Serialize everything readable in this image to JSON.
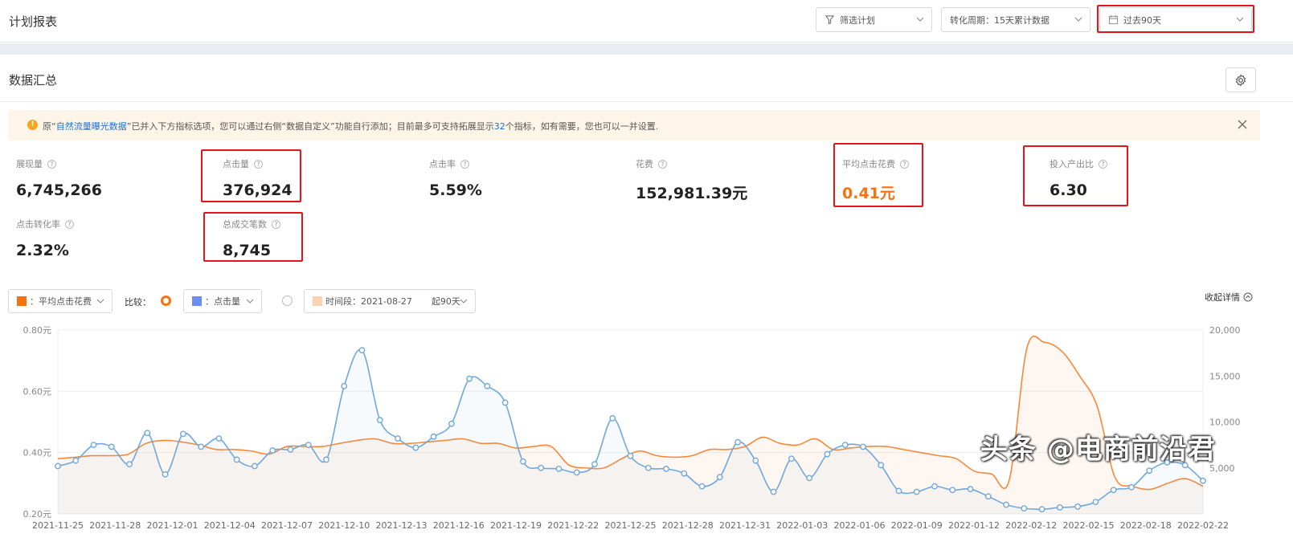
{
  "header": {
    "title": "计划报表",
    "filter_label": "筛选计划",
    "period_label": "转化周期：15天累计数据",
    "range_label": "过去90天"
  },
  "summary": {
    "title": "数据汇总",
    "notice_pre": "原“",
    "notice_link": "自然流量曝光数据",
    "notice_mid": "”已并入下方指标选项，您可以通过右侧“数据自定义”功能自行添加；目前最多可支持拓展显示",
    "notice_num": "32",
    "notice_post": "个指标，如有需要，您也可以一并设置."
  },
  "metrics": [
    {
      "label": "展现量",
      "value": "6,745,266"
    },
    {
      "label": "点击量",
      "value": "376,924"
    },
    {
      "label": "点击率",
      "value": "5.59%"
    },
    {
      "label": "花费",
      "value": "152,981.39元"
    },
    {
      "label": "平均点击花费",
      "value": "0.41元"
    },
    {
      "label": "投入产出比",
      "value": "6.30"
    },
    {
      "label": "点击转化率",
      "value": "2.32%"
    },
    {
      "label": "总成交笔数",
      "value": "8,745"
    }
  ],
  "controls": {
    "primary_metric": "：平均点击花费",
    "compare_label": "比较：",
    "secondary_metric": "：点击量",
    "period_text": "时间段：2021-08-27",
    "period_suffix": "起90天",
    "collapse_label": "收起详情"
  },
  "colors": {
    "orange": "#f7883a",
    "blue": "#6fa8dc",
    "red_highlight": "#e3141c",
    "radio_active": "#f7720f"
  },
  "chart_data": {
    "type": "line",
    "x_ticks": [
      "2021-11-25",
      "2021-11-28",
      "2021-12-01",
      "2021-12-04",
      "2021-12-07",
      "2021-12-10",
      "2021-12-13",
      "2021-12-16",
      "2021-12-19",
      "2021-12-22",
      "2021-12-25",
      "2021-12-28",
      "2021-12-31",
      "2022-01-03",
      "2022-01-06",
      "2022-01-09",
      "2022-01-12",
      "2022-02-12",
      "2022-02-15",
      "2022-02-18",
      "2022-02-22"
    ],
    "y_left_ticks": [
      "0.20元",
      "0.40元",
      "0.60元",
      "0.80元"
    ],
    "y_left_range": [
      0.2,
      0.8
    ],
    "y_right_ticks": [
      "0",
      "5,000",
      "10,000",
      "15,000",
      "20,000"
    ],
    "y_right_range": [
      0,
      20000
    ],
    "series": [
      {
        "name": "平均点击花费",
        "axis": "left",
        "values": [
          0.38,
          0.385,
          0.39,
          0.39,
          0.395,
          0.43,
          0.44,
          0.435,
          0.425,
          0.41,
          0.41,
          0.405,
          0.395,
          0.42,
          0.42,
          0.42,
          0.43,
          0.44,
          0.445,
          0.43,
          0.43,
          0.435,
          0.44,
          0.445,
          0.43,
          0.43,
          0.415,
          0.42,
          0.42,
          0.36,
          0.35,
          0.35,
          0.38,
          0.405,
          0.39,
          0.385,
          0.39,
          0.41,
          0.41,
          0.42,
          0.45,
          0.43,
          0.425,
          0.445,
          0.41,
          0.415,
          0.42,
          0.42,
          0.41,
          0.4,
          0.39,
          0.38,
          0.34,
          0.33,
          0.31,
          0.74,
          0.76,
          0.73,
          0.65,
          0.55,
          0.32,
          0.29,
          0.28,
          0.3,
          0.315,
          0.29
        ]
      },
      {
        "name": "点击量",
        "axis": "right",
        "values": [
          5200,
          5800,
          7500,
          7300,
          5400,
          8800,
          4300,
          8700,
          7300,
          8200,
          5900,
          5200,
          6900,
          7000,
          7500,
          5900,
          13900,
          17800,
          10200,
          8200,
          7200,
          8400,
          9800,
          14700,
          13900,
          12100,
          5700,
          5000,
          4900,
          4500,
          5400,
          10400,
          6300,
          5000,
          4900,
          4400,
          3000,
          4000,
          7800,
          5800,
          2400,
          6000,
          3900,
          6500,
          7500,
          7300,
          5300,
          2500,
          2400,
          3000,
          2600,
          2700,
          1900,
          1000,
          600,
          500,
          700,
          800,
          1300,
          2600,
          2900,
          4700,
          5600,
          5300,
          3600
        ]
      }
    ]
  },
  "watermark": "头条 @电商前沿君"
}
